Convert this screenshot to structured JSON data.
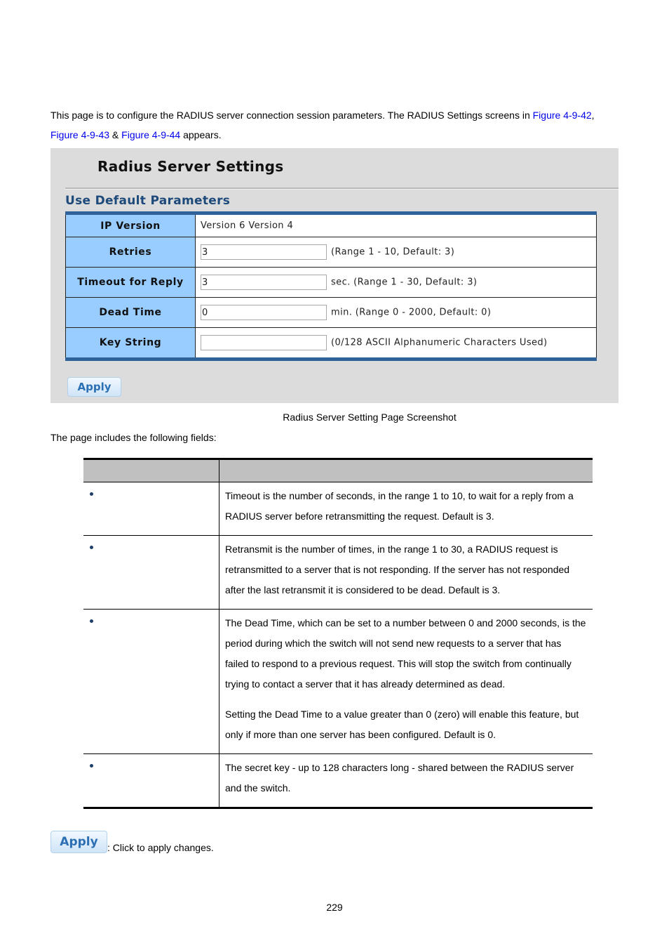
{
  "intro": {
    "text_before": "This page is to configure the RADIUS server connection session parameters. The RADIUS Settings screens in ",
    "link1": "Figure 4-9-42",
    "sep1": ", ",
    "link2": "Figure 4-9-43",
    "sep2": " & ",
    "link3": "Figure 4-9-44",
    "text_after": " appears."
  },
  "panel": {
    "title": "Radius Server Settings",
    "section_title": "Use Default Parameters",
    "rows": [
      {
        "label": "IP Version",
        "value": "Version 6 Version 4"
      },
      {
        "label": "Retries",
        "input_value": "3",
        "hint": "(Range 1 - 10, Default: 3)"
      },
      {
        "label": "Timeout for Reply",
        "input_value": "3",
        "hint": "sec. (Range 1 - 30, Default: 3)"
      },
      {
        "label": "Dead Time",
        "input_value": "0",
        "hint": "min. (Range 0 - 2000, Default: 0)"
      },
      {
        "label": "Key String",
        "input_value": "",
        "hint": "(0/128 ASCII Alphanumeric Characters Used)"
      }
    ],
    "apply_label": "Apply"
  },
  "caption": "Radius Server Setting Page Screenshot",
  "fields_intro": "The page includes the following fields:",
  "desc_table": {
    "headers": [
      "",
      ""
    ],
    "rows": [
      {
        "object": "",
        "description": [
          "Timeout is the number of seconds, in the range 1 to 10, to wait for a reply from a RADIUS server before retransmitting the request. Default is 3."
        ]
      },
      {
        "object": "",
        "description": [
          "Retransmit is the number of times, in the range 1 to 30, a RADIUS request is retransmitted to a server that is not responding. If the server has not responded after the last retransmit it is considered to be dead. Default is 3."
        ]
      },
      {
        "object": "",
        "description": [
          "The Dead Time, which can be set to a number between 0 and 2000 seconds, is the period during which the switch will not send new requests to a server that has failed to respond to a previous request. This will stop the switch from continually trying to contact a server that it has already determined as dead.",
          "Setting the Dead Time to a value greater than 0 (zero) will enable this feature, but only if more than one server has been configured. Default is 0."
        ]
      },
      {
        "object": "",
        "description": [
          "The secret key - up to 128 characters long - shared between the RADIUS server and the switch."
        ]
      }
    ]
  },
  "apply_note": {
    "button_label": "Apply",
    "text": ": Click to apply changes."
  },
  "page_number": "229",
  "colors": {
    "link": "#0000ee",
    "label_cell_bg": "#99ccff",
    "table_accent": "#2f6298",
    "section_title": "#1d4a7a",
    "panel_bg": "#dcdcdc",
    "header_gray": "#c0c0c0"
  }
}
